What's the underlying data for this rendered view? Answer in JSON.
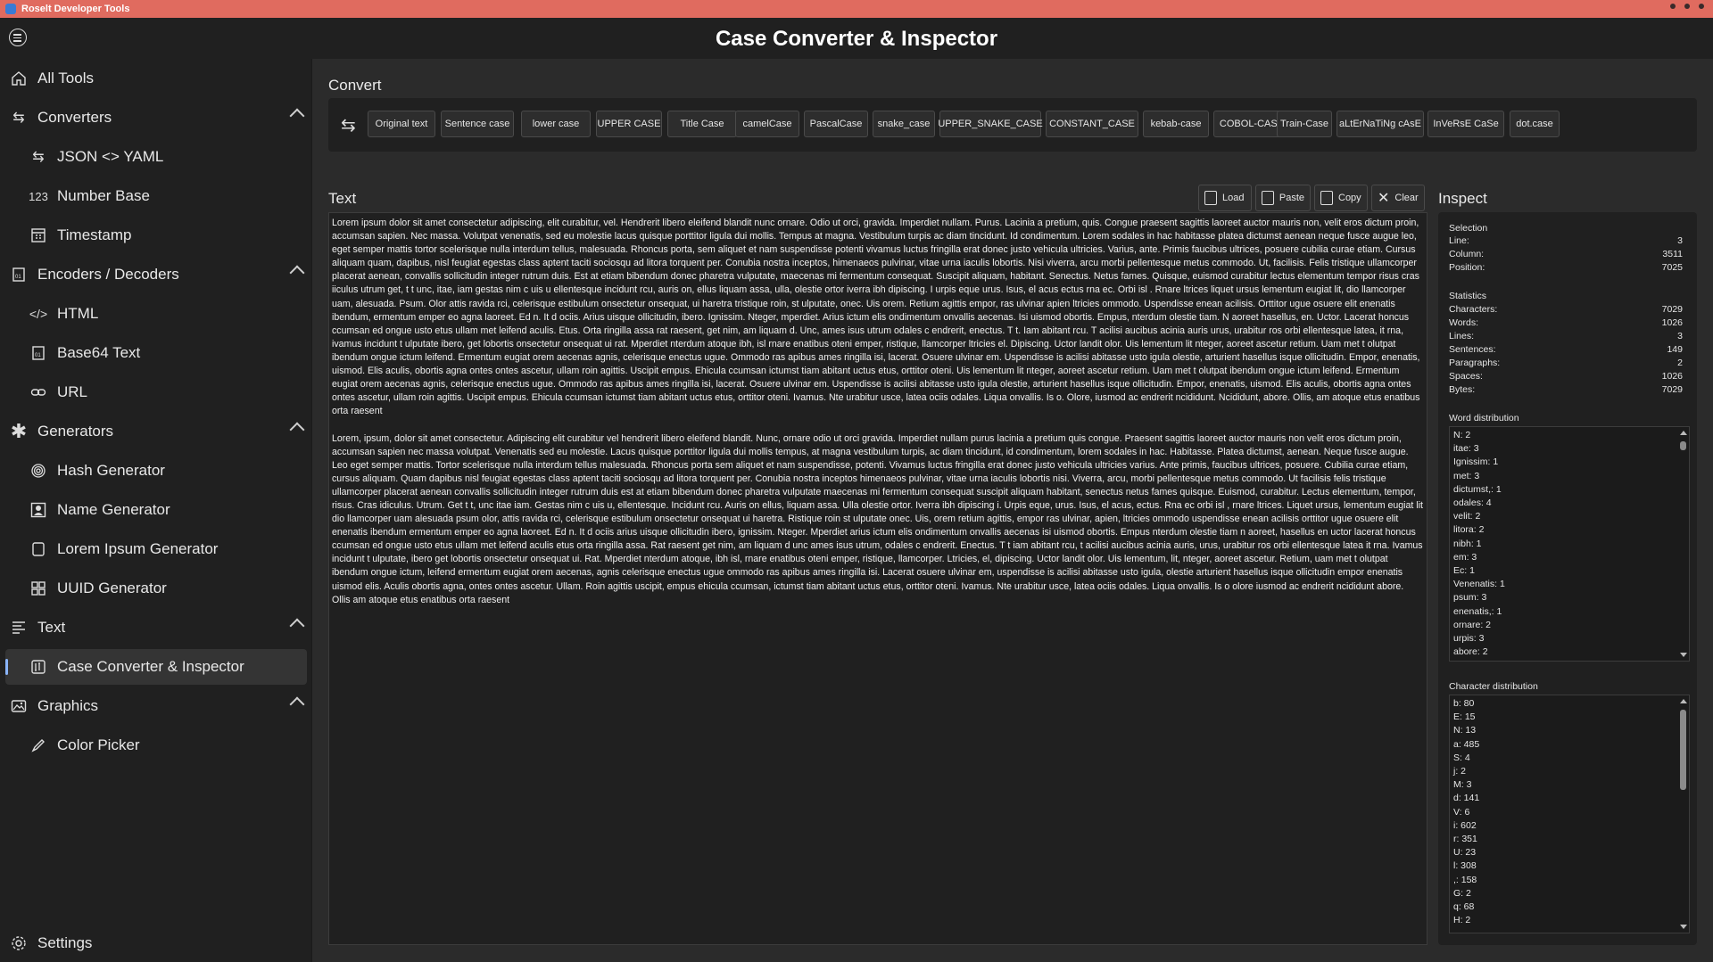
{
  "window": {
    "title": "Roselt Developer Tools"
  },
  "header": {
    "title": "Case Converter & Inspector"
  },
  "sidebar": {
    "items": [
      {
        "label": "All Tools",
        "icon": "home-icon"
      },
      {
        "label": "Converters",
        "icon": "arrows-icon"
      },
      {
        "label": "JSON <> YAML",
        "icon": "arrows-icon"
      },
      {
        "label": "Number Base",
        "icon": "123-icon"
      },
      {
        "label": "Timestamp",
        "icon": "calendar-icon"
      },
      {
        "label": "Encoders / Decoders",
        "icon": "binary-icon"
      },
      {
        "label": "HTML",
        "icon": "code-icon"
      },
      {
        "label": "Base64 Text",
        "icon": "binary-icon"
      },
      {
        "label": "URL",
        "icon": "link-icon"
      },
      {
        "label": "Generators",
        "icon": "asterisk-icon"
      },
      {
        "label": "Hash Generator",
        "icon": "fingerprint-icon"
      },
      {
        "label": "Name Generator",
        "icon": "person-icon"
      },
      {
        "label": "Lorem Ipsum Generator",
        "icon": "document-icon"
      },
      {
        "label": "UUID Generator",
        "icon": "grid-icon"
      },
      {
        "label": "Text",
        "icon": "text-icon"
      },
      {
        "label": "Case Converter & Inspector",
        "icon": "case-icon"
      },
      {
        "label": "Graphics",
        "icon": "image-icon"
      },
      {
        "label": "Color Picker",
        "icon": "pen-icon"
      }
    ],
    "settings_label": "Settings"
  },
  "convert": {
    "label": "Convert",
    "buttons": [
      "Original text",
      "Sentence case",
      "lower case",
      "UPPER CASE",
      "Title Case",
      "camelCase",
      "PascalCase",
      "snake_case",
      "UPPER_SNAKE_CASE",
      "CONSTANT_CASE",
      "kebab-case",
      "COBOL-CASE",
      "Train-Case",
      "aLtErNaTiNg cAsE",
      "InVeRsE CaSe",
      "dot.case"
    ]
  },
  "text": {
    "label": "Text",
    "buttons": {
      "load": "Load",
      "paste": "Paste",
      "copy": "Copy",
      "clear": "Clear"
    },
    "content": "Lorem ipsum dolor sit amet consectetur adipiscing, elit curabitur, vel. Hendrerit libero eleifend blandit nunc ornare. Odio ut orci, gravida. Imperdiet nullam. Purus. Lacinia a pretium, quis. Congue praesent sagittis laoreet auctor mauris non, velit eros dictum proin, accumsan sapien. Nec massa. Volutpat venenatis, sed eu molestie lacus quisque porttitor ligula dui mollis. Tempus at magna. Vestibulum turpis ac diam tincidunt. Id condimentum. Lorem sodales in hac habitasse platea dictumst aenean neque fusce augue leo, eget semper mattis tortor scelerisque nulla interdum tellus, malesuada. Rhoncus porta, sem aliquet et nam suspendisse potenti vivamus luctus fringilla erat donec justo vehicula ultricies. Varius, ante. Primis faucibus ultrices, posuere cubilia curae etiam. Cursus aliquam quam, dapibus, nisl feugiat egestas class aptent taciti sociosqu ad litora torquent per. Conubia nostra inceptos, himenaeos pulvinar, vitae urna iaculis lobortis. Nisi viverra, arcu morbi pellentesque metus commodo. Ut, facilisis. Felis tristique ullamcorper placerat aenean, convallis sollicitudin integer rutrum duis. Est at etiam bibendum donec pharetra vulputate, maecenas mi fermentum consequat. Suscipit aliquam, habitant. Senectus. Netus fames. Quisque, euismod curabitur lectus elementum tempor risus cras iiculus utrum get, t t unc, itae, iam gestas nim c uis u ellentesque incidunt rcu, auris on, ellus liquam assa, ulla, olestie ortor iverra ibh dipiscing. I urpis eque urus. Isus, el acus ectus rna ec. Orbi isl . Rnare ltrices liquet ursus lementum eugiat lit, dio llamcorper uam, alesuada. Psum. Olor attis ravida rci, celerisque estibulum onsectetur onsequat, ui haretra tristique roin, st ulputate, onec. Uis orem. Retium agittis empor, ras ulvinar apien ltricies ommodo. Uspendisse enean acilisis. Orttitor ugue osuere elit enenatis ibendum, ermentum emper eo agna laoreet. Ed n. It d ociis. Arius uisque ollicitudin, ibero. Ignissim. Nteger, mperdiet. Arius ictum elis ondimentum onvallis aecenas. Isi uismod obortis. Empus, nterdum olestie tiam. N aoreet hasellus, en. Uctor. Lacerat honcus ccumsan ed ongue usto etus ullam met leifend aculis. Etus. Orta ringilla assa rat raesent, get nim, am liquam d. Unc, ames isus utrum odales c endrerit, enectus. T t. Iam abitant rcu. T acilisi aucibus acinia auris urus, urabitur ros orbi ellentesque latea, it rna, ivamus incidunt t ulputate ibero, get lobortis onsectetur onsequat ui rat. Mperdiet nterdum atoque ibh, isl rnare enatibus oteni emper, ristique, llamcorper ltricies el. Dipiscing. Uctor landit olor. Uis lementum lit nteger, aoreet ascetur retium. Uam met t olutpat ibendum ongue ictum leifend. Ermentum eugiat orem aecenas agnis, celerisque enectus ugue. Ommodo ras apibus ames ringilla isi, lacerat. Osuere ulvinar em. Uspendisse is acilisi abitasse usto igula olestie, arturient hasellus isque ollicitudin. Empor, enenatis, uismod. Elis aculis, obortis agna ontes ontes ascetur, ullam roin agittis. Uscipit empus. Ehicula ccumsan ictumst tiam abitant uctus etus, orttitor oteni. Uis lementum lit nteger, aoreet ascetur retium. Uam met t olutpat ibendum ongue ictum leifend. Ermentum eugiat orem aecenas agnis, celerisque enectus ugue. Ommodo ras apibus ames ringilla isi, lacerat. Osuere ulvinar em. Uspendisse is acilisi abitasse usto igula olestie, arturient hasellus isque ollicitudin. Empor, enenatis, uismod. Elis aculis, obortis agna ontes ontes ascetur, ullam roin agittis. Uscipit empus. Ehicula ccumsan ictumst tiam abitant uctus etus, orttitor oteni. Ivamus. Nte urabitur usce, latea ociis odales. Liqua onvallis. Is o. Olore, iusmod ac endrerit ncididunt. Ncididunt, abore. Ollis, am atoque etus enatibus orta raesent\n\nLorem, ipsum, dolor sit amet consectetur. Adipiscing elit curabitur vel hendrerit libero eleifend blandit. Nunc, ornare odio ut orci gravida. Imperdiet nullam purus lacinia a pretium quis congue. Praesent sagittis laoreet auctor mauris non velit eros dictum proin, accumsan sapien nec massa volutpat. Venenatis sed eu molestie. Lacus quisque porttitor ligula dui mollis tempus, at magna vestibulum turpis, ac diam tincidunt, id condimentum, lorem sodales in hac. Habitasse. Platea dictumst, aenean. Neque fusce augue. Leo eget semper mattis. Tortor scelerisque nulla interdum tellus malesuada. Rhoncus porta sem aliquet et nam suspendisse, potenti. Vivamus luctus fringilla erat donec justo vehicula ultricies varius. Ante primis, faucibus ultrices, posuere. Cubilia curae etiam, cursus aliquam. Quam dapibus nisl feugiat egestas class aptent taciti sociosqu ad litora torquent per. Conubia nostra inceptos himenaeos pulvinar, vitae urna iaculis lobortis nisi. Viverra, arcu, morbi pellentesque metus commodo. Ut facilisis felis tristique ullamcorper placerat aenean convallis sollicitudin integer rutrum duis est at etiam bibendum donec pharetra vulputate maecenas mi fermentum consequat suscipit aliquam habitant, senectus netus fames quisque. Euismod, curabitur. Lectus elementum, tempor, risus. Cras idiculus. Utrum. Get t t, unc itae iam. Gestas nim c uis u, ellentesque. Incidunt rcu. Auris on ellus, liquam assa. Ulla olestie ortor. Iverra ibh dipiscing i. Urpis eque, urus. Isus, el acus, ectus. Rna ec orbi isl , rnare ltrices. Liquet ursus, lementum eugiat lit dio llamcorper uam alesuada psum olor, attis ravida rci, celerisque estibulum onsectetur onsequat ui haretra. Ristique roin st ulputate onec. Uis, orem retium agittis, empor ras ulvinar, apien, ltricies ommodo uspendisse enean acilisis orttitor ugue osuere elit enenatis ibendum ermentum emper eo agna laoreet. Ed n. It d ociis arius uisque ollicitudin ibero, ignissim. Nteger. Mperdiet arius ictum elis ondimentum onvallis aecenas isi uismod obortis. Empus nterdum olestie tiam n aoreet, hasellus en uctor lacerat honcus ccumsan ed ongue usto etus ullam met leifend aculis etus orta ringilla assa. Rat raesent get nim, am liquam d unc ames isus utrum, odales c endrerit. Enectus. T t iam abitant rcu, t acilisi aucibus acinia auris, urus, urabitur ros orbi ellentesque latea it rna. Ivamus incidunt t ulputate, ibero get lobortis onsectetur onsequat ui. Rat. Mperdiet nterdum atoque, ibh isl, rnare enatibus oteni emper, ristique, llamcorper. Ltricies, el, dipiscing. Uctor landit olor. Uis lementum, lit, nteger, aoreet ascetur. Retium, uam met t olutpat ibendum ongue ictum, leifend ermentum eugiat orem aecenas, agnis celerisque enectus ugue ommodo ras apibus ames ringilla isi. Lacerat osuere ulvinar em, uspendisse is acilisi abitasse usto igula, olestie arturient hasellus isque ollicitudin empor enenatis uismod elis. Aculis obortis agna, ontes ontes ascetur. Ullam. Roin agittis uscipit, empus ehicula ccumsan, ictumst tiam abitant uctus etus, orttitor oteni. Ivamus. Nte urabitur usce, latea ociis odales. Liqua onvallis. Is o olore iusmod ac endrerit ncididunt abore. Ollis am atoque etus enatibus orta raesent"
  },
  "inspect": {
    "label": "Inspect",
    "selection": {
      "title": "Selection",
      "rows": [
        {
          "k": "Line:",
          "v": "3"
        },
        {
          "k": "Column:",
          "v": "3511"
        },
        {
          "k": "Position:",
          "v": "7025"
        }
      ]
    },
    "statistics": {
      "title": "Statistics",
      "rows": [
        {
          "k": "Characters:",
          "v": "7029"
        },
        {
          "k": "Words:",
          "v": "1026"
        },
        {
          "k": "Lines:",
          "v": "3"
        },
        {
          "k": "Sentences:",
          "v": "149"
        },
        {
          "k": "Paragraphs:",
          "v": "2"
        },
        {
          "k": "Spaces:",
          "v": "1026"
        },
        {
          "k": "Bytes:",
          "v": "7029"
        }
      ]
    },
    "word_distribution": {
      "title": "Word distribution",
      "items": [
        "N: 2",
        "itae: 3",
        "Ignissim: 1",
        "met: 3",
        "dictumst,: 1",
        "odales: 4",
        "velit: 2",
        "litora: 2",
        "nibh: 1",
        "em: 3",
        "Ec: 1",
        "Venenatis: 1",
        "psum: 3",
        "enenatis,: 1",
        "ornare: 2",
        "urpis: 3",
        "abore: 2"
      ]
    },
    "character_distribution": {
      "title": "Character distribution",
      "items": [
        "b: 80",
        "E: 15",
        "N: 13",
        "a: 485",
        "S: 4",
        "j: 2",
        "M: 3",
        "d: 141",
        "V: 6",
        "i: 602",
        "r: 351",
        "U: 23",
        "l: 308",
        ",: 158",
        "G: 2",
        "q: 68",
        "H: 2"
      ]
    }
  }
}
